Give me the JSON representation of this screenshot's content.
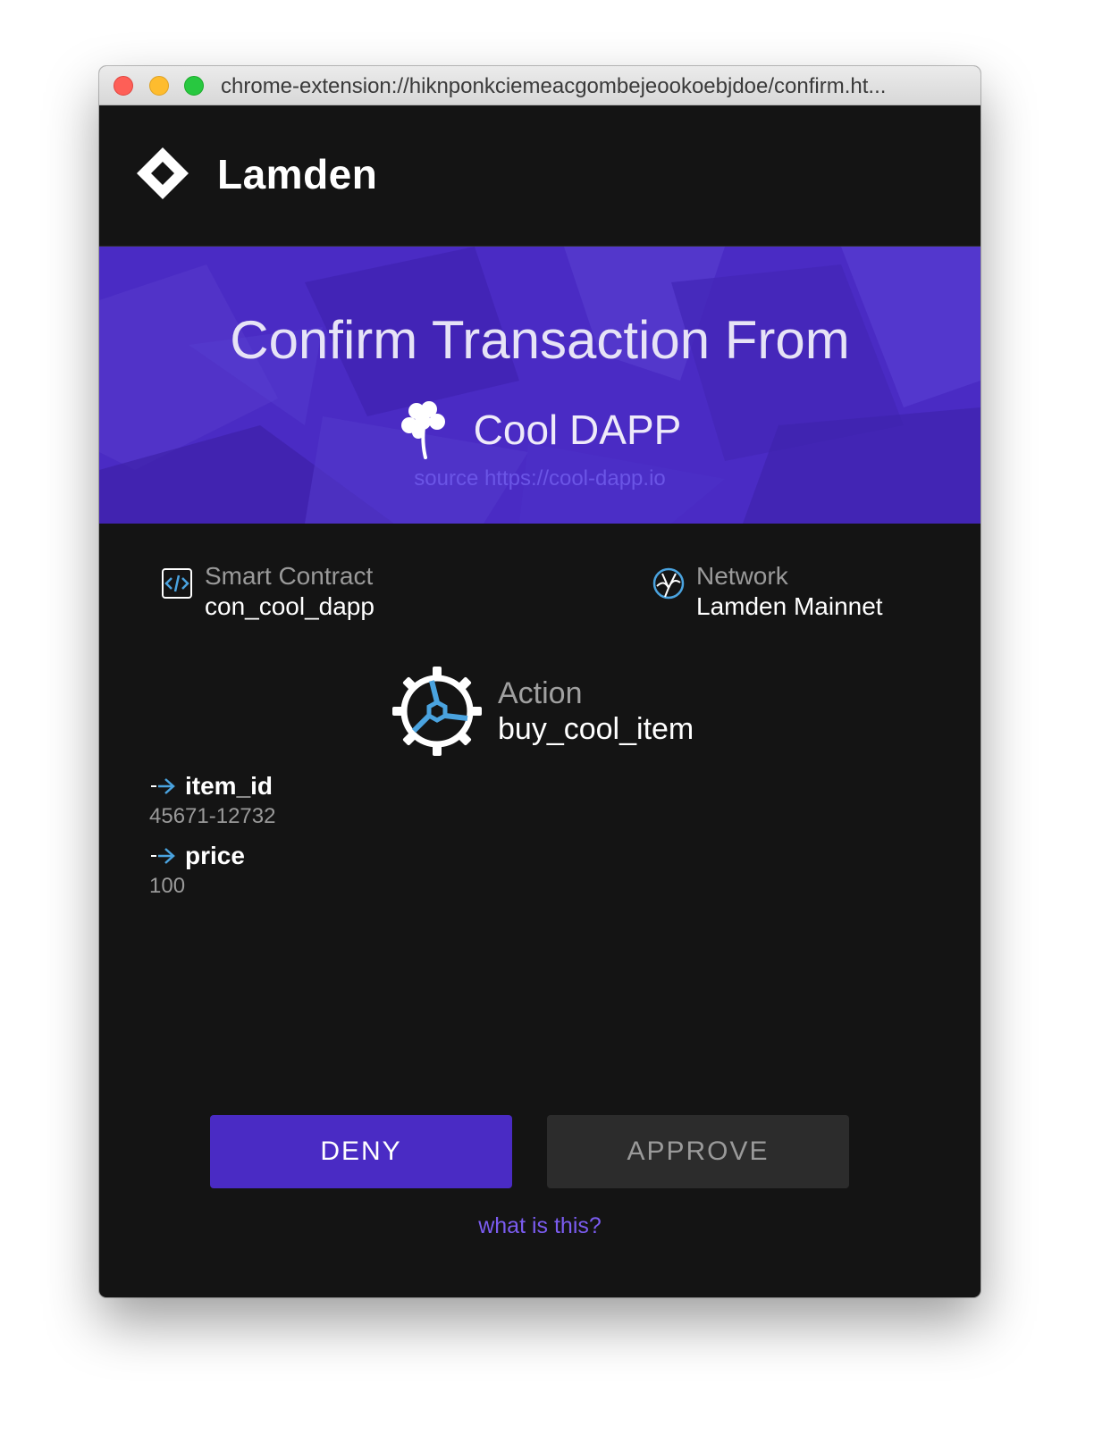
{
  "window": {
    "url": "chrome-extension://hiknponkciemeacgombejeookoebjdoe/confirm.ht..."
  },
  "header": {
    "brand": "Lamden"
  },
  "banner": {
    "title": "Confirm Transaction From",
    "dapp_name": "Cool DAPP",
    "source": "source https://cool-dapp.io"
  },
  "contract": {
    "label": "Smart Contract",
    "value": "con_cool_dapp",
    "icon": "code-icon"
  },
  "network": {
    "label": "Network",
    "value": "Lamden Mainnet",
    "icon": "network-icon"
  },
  "action": {
    "label": "Action",
    "value": "buy_cool_item",
    "icon": "gear-icon"
  },
  "kwargs": [
    {
      "name": "item_id",
      "value": "45671-12732"
    },
    {
      "name": "price",
      "value": "100"
    }
  ],
  "buttons": {
    "deny": "DENY",
    "approve": "APPROVE"
  },
  "help": {
    "link": "what is this?"
  },
  "colors": {
    "brand_purple": "#4a2bc4",
    "background": "#141414",
    "accent_blue": "#4aa3df",
    "link": "#7b5cf0"
  }
}
